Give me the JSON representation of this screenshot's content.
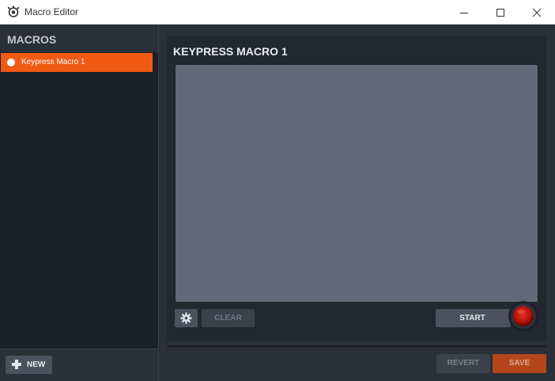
{
  "window": {
    "title": "Macro Editor"
  },
  "sidebar": {
    "title": "MACROS",
    "items": [
      {
        "label": "Keypress Macro 1",
        "selected": true
      }
    ],
    "new_label": "NEW"
  },
  "main": {
    "title": "KEYPRESS MACRO 1",
    "clear_label": "CLEAR",
    "start_label": "START"
  },
  "footer": {
    "revert_label": "REVERT",
    "save_label": "SAVE"
  },
  "colors": {
    "accent": "#f15a12",
    "save": "#b5461c",
    "record": "#c41a10"
  },
  "icons": [
    "app-icon",
    "minimize-icon",
    "maximize-icon",
    "close-icon",
    "plus-icon",
    "gear-icon",
    "record-icon"
  ]
}
